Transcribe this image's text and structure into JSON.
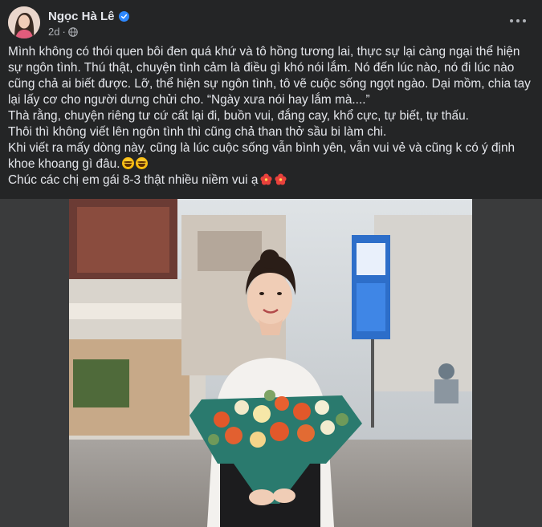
{
  "post": {
    "author": "Ngọc Hà Lê",
    "time": "2d",
    "paragraphs": [
      "Mình không có thói quen bôi đen quá khứ và tô hồng tương lai, thực sự lại càng ngại thể hiện sự ngôn tình. Thú thật, chuyện tình cảm là điều gì khó nói lắm. Nó đến lúc nào, nó đi lúc nào cũng chả ai biết được. Lỡ, thể hiện sự ngôn tình, tô vẽ cuộc sống ngọt ngào. Dại mồm, chia tay lại lấy cơ cho người dưng chửi cho. “Ngày xưa nói hay lắm mà....”",
      "Thà rằng, chuyện riêng tư cứ cất lại đi, buồn vui, đắng cay, khổ cực, tự biết, tự thấu.",
      "Thôi thì không viết lên ngôn tình thì cũng chả than thở sầu bi làm chi.",
      "Khi viết ra mấy dòng này, cũng là lúc cuộc sống vẫn bình yên, vẫn vui vẻ và cũng k có ý định khoe khoang gì đâu.",
      "Chúc các chị em gái 8-3 thật nhiều niềm vui ạ"
    ]
  },
  "icons": {
    "verified": "verified-badge-icon",
    "privacy": "globe-icon",
    "more": "more-options-icon",
    "emoji_laugh": "laughing-tears-emoji",
    "emoji_flower": "hibiscus-emoji"
  },
  "colors": {
    "background": "#242526",
    "text": "#e4e6eb",
    "secondary": "#b0b3b8",
    "verified": "#2d88ff"
  }
}
